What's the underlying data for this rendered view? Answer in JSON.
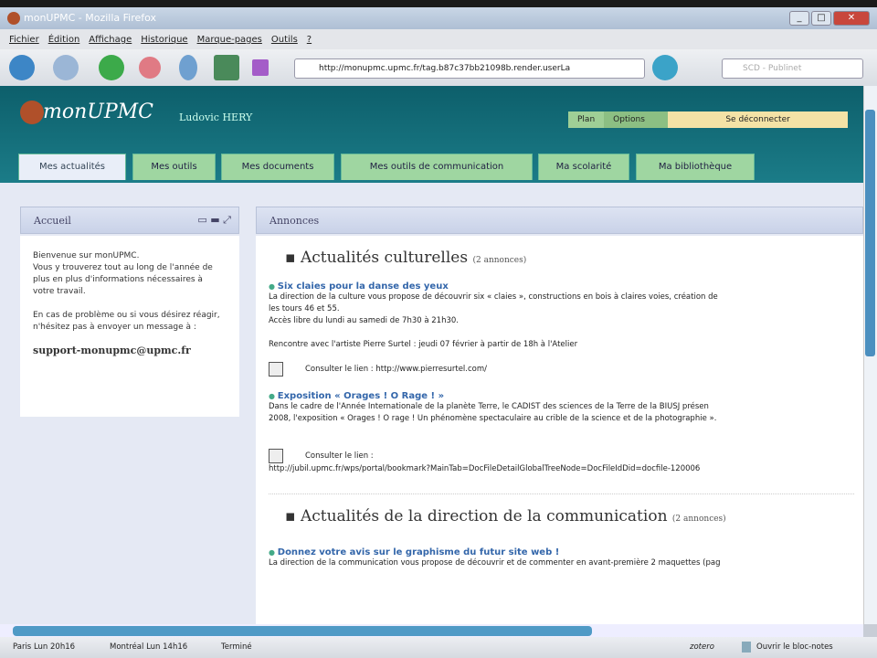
{
  "window": {
    "title": "monUPMC - Mozilla Firefox"
  },
  "menu": [
    "Fichier",
    "Édition",
    "Affichage",
    "Historique",
    "Marque-pages",
    "Outils",
    "?"
  ],
  "toolbar": {
    "url": "http://monupmc.upmc.fr/tag.b87c37bb21098b.render.userLa",
    "search_placeholder": "SCD - Publinet"
  },
  "header": {
    "logo": "monUPMC",
    "user": "Ludovic HERY",
    "buttons": [
      "Plan",
      "Options",
      "Se déconnecter"
    ]
  },
  "tabs": [
    "Mes actualités",
    "Mes outils",
    "Mes documents",
    "Mes outils de communication",
    "Ma scolarité",
    "Ma bibliothèque"
  ],
  "left": {
    "title": "Accueil",
    "paragraphs": [
      "Bienvenue sur monUPMC.",
      "Vous y trouverez tout au long de l'année de plus en plus d'informations nécessaires à votre travail.",
      "En cas de problème ou si vous désirez réagir, n'hésitez pas à envoyer un message à :"
    ],
    "email": "support-monupmc@upmc.fr"
  },
  "main": {
    "title": "Annonces",
    "sections": [
      {
        "title": "Actualités culturelles",
        "count": "(2 annonces)",
        "items": [
          {
            "title": "Six claies pour la danse des yeux",
            "lines": [
              "La direction de la culture vous propose de découvrir six « claies », constructions en bois à claires voies, création de",
              "les tours 46 et 55.",
              "Accès libre du lundi au samedi de 7h30 à 21h30.",
              "",
              "Rencontre avec l'artiste Pierre Surtel : jeudi 07 février à partir de 18h à l'Atelier"
            ],
            "link_label": "Consulter le lien : http://www.pierresurtel.com/",
            "link_url": ""
          },
          {
            "title": "Exposition « Orages ! O Rage ! »",
            "lines": [
              "Dans le cadre de l'Année Internationale de la planète Terre, le CADIST des sciences de la Terre de la BIUSJ présen",
              "2008, l'exposition « Orages ! O rage ! Un phénomène spectaculaire au crible de la science et de la photographie »."
            ],
            "link_label": "Consulter le lien :",
            "link_url": "http://jubil.upmc.fr/wps/portal/bookmark?MainTab=DocFileDetailGlobalTreeNode=DocFileIdDid=docfile-120006"
          }
        ]
      },
      {
        "title": "Actualités de la direction de la communication",
        "count": "(2 annonces)",
        "items": [
          {
            "title": "Donnez votre avis sur le graphisme du futur site web !",
            "lines": [
              "La direction de la communication vous propose de découvrir et de commenter en avant-première 2 maquettes (pag"
            ]
          }
        ]
      }
    ]
  },
  "status": {
    "clock1": "Paris Lun 20h16",
    "clock2": "Montréal Lun 14h16",
    "state": "Terminé",
    "zotero": "zotero",
    "notes": "Ouvrir le bloc-notes"
  }
}
